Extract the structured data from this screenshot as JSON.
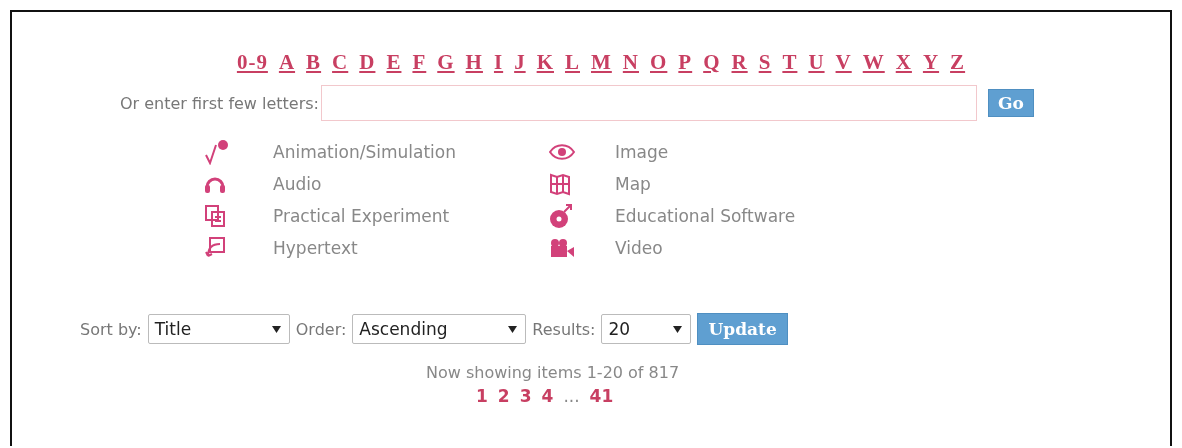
{
  "letters": [
    "0-9",
    "A",
    "B",
    "C",
    "D",
    "E",
    "F",
    "G",
    "H",
    "I",
    "J",
    "K",
    "L",
    "M",
    "N",
    "O",
    "P",
    "Q",
    "R",
    "S",
    "T",
    "U",
    "V",
    "W",
    "X",
    "Y",
    "Z"
  ],
  "search": {
    "label": "Or enter first few letters:",
    "button": "Go"
  },
  "legend": [
    {
      "kind": "animation",
      "label": "Animation/Simulation"
    },
    {
      "kind": "image",
      "label": "Image"
    },
    {
      "kind": "audio",
      "label": "Audio"
    },
    {
      "kind": "map",
      "label": "Map"
    },
    {
      "kind": "experiment",
      "label": "Practical Experiment"
    },
    {
      "kind": "software",
      "label": "Educational Software"
    },
    {
      "kind": "hypertext",
      "label": "Hypertext"
    },
    {
      "kind": "video",
      "label": "Video"
    }
  ],
  "controls": [
    {
      "label": "Sort by:",
      "value": "Title"
    },
    {
      "label": "Order:",
      "value": "Ascending"
    },
    {
      "label": "Results:",
      "value": "20"
    }
  ],
  "update_button": "Update",
  "summary": "Now showing items 1-20 of 817",
  "pagination": [
    {
      "label": "1",
      "kind": "link"
    },
    {
      "label": "2",
      "kind": "link"
    },
    {
      "label": "3",
      "kind": "link"
    },
    {
      "label": "4",
      "kind": "link"
    },
    {
      "label": "...",
      "kind": "gap"
    },
    {
      "label": "41",
      "kind": "link"
    }
  ]
}
